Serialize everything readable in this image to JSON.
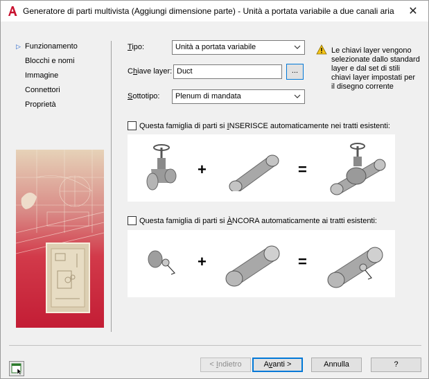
{
  "window": {
    "title": "Generatore di parti multivista (Aggiungi dimensione parte) - Unità a portata variabile a due canali aria",
    "close_glyph": "✕",
    "app_icon": "autocad-a-icon",
    "accent_color": "#c8102e"
  },
  "nav": {
    "arrow_glyph": "▷",
    "items": [
      {
        "label": "Funzionamento",
        "active": true
      },
      {
        "label": "Blocchi e nomi",
        "active": false
      },
      {
        "label": "Immagine",
        "active": false
      },
      {
        "label": "Connettori",
        "active": false
      },
      {
        "label": "Proprietà",
        "active": false
      }
    ]
  },
  "form": {
    "tipo_prefix": "",
    "tipo_accel": "T",
    "tipo_rest": "ipo:",
    "tipo_value": "Unità a portata variabile",
    "chiave_prefix": "C",
    "chiave_accel": "h",
    "chiave_rest": "iave layer:",
    "chiave_value": "Duct",
    "browse_label": "...",
    "sotto_prefix": "",
    "sotto_accel": "S",
    "sotto_rest": "ottotipo:",
    "sotto_value": "Plenum di mandata"
  },
  "warning": {
    "icon": "warning-triangle-icon",
    "text": "Le chiavi layer vengono selezionate dallo standard layer e dal set di stili chiavi layer impostati per il disegno corrente"
  },
  "insert_option": {
    "prefix": "Questa famiglia di parti si ",
    "accel": "I",
    "rest": "NSERISCE automaticamente nei tratti esistenti:",
    "checked": false,
    "plus": "+",
    "equals": "="
  },
  "anchor_option": {
    "prefix": "Questa famiglia di parti si ",
    "accel": "À",
    "rest": "NCORA automaticamente ai tratti esistenti:",
    "checked": false,
    "plus": "+",
    "equals": "="
  },
  "buttons": {
    "back": "< Indietro",
    "back_accel": "I",
    "next": "Avanti >",
    "next_accel": "v",
    "cancel": "Annulla",
    "help": "?"
  }
}
